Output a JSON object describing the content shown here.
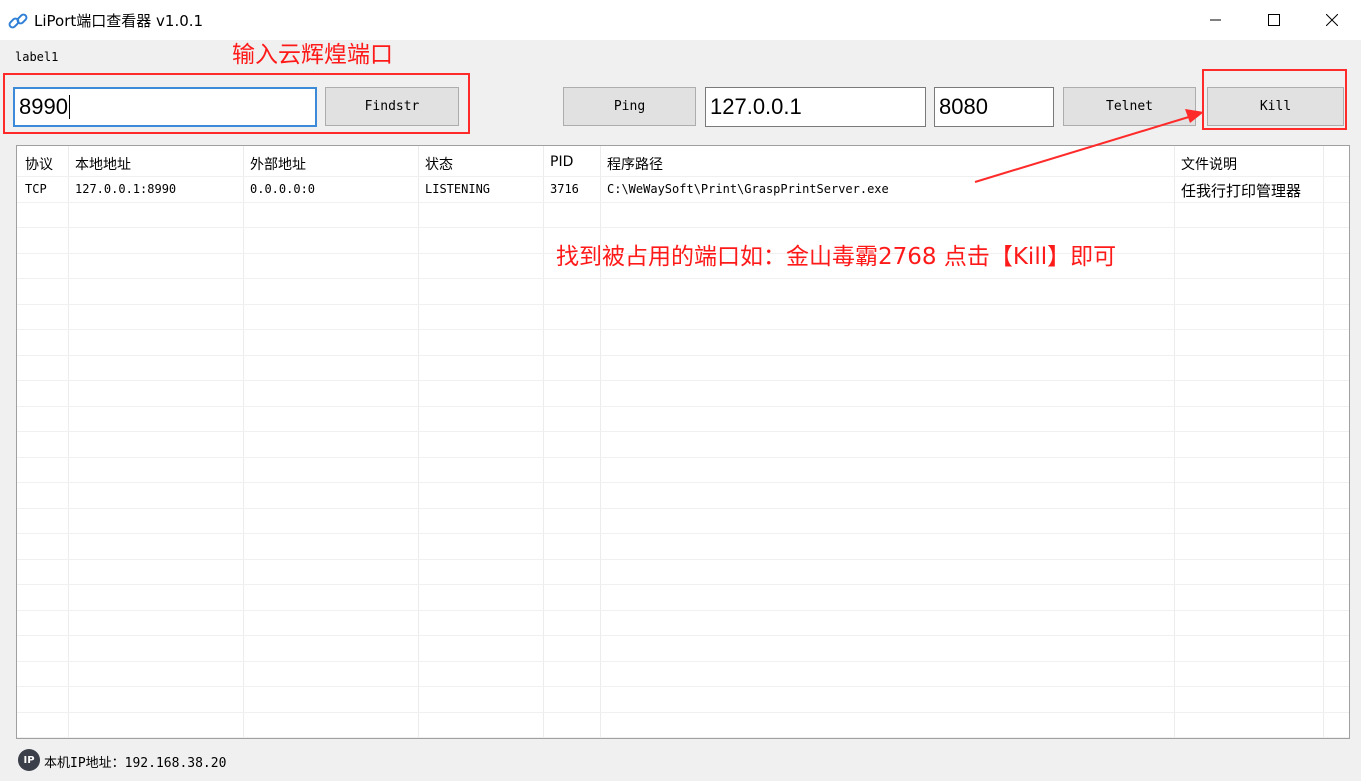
{
  "window": {
    "title": "LiPort端口查看器 v1.0.1",
    "icon": "link-icon"
  },
  "label1": "label1",
  "annotations": {
    "input_hint": "输入云辉煌端口",
    "main_hint": "找到被占用的端口如：金山毒霸2768  点击【Kill】即可",
    "color": "#ff1a1a"
  },
  "toolbar": {
    "port_input_value": "8990",
    "findstr_label": "Findstr",
    "ping_label": "Ping",
    "ip_input_value": "127.0.0.1",
    "telnet_port_value": "8080",
    "telnet_label": "Telnet",
    "kill_label": "Kill"
  },
  "table": {
    "columns": [
      "协议",
      "本地地址",
      "外部地址",
      "状态",
      "PID",
      "程序路径",
      "文件说明"
    ],
    "rows": [
      [
        "TCP",
        "127.0.0.1:8990",
        "0.0.0.0:0",
        "LISTENING",
        "3716",
        "C:\\WeWaySoft\\Print\\GraspPrintServer.exe",
        "任我行打印管理器"
      ]
    ]
  },
  "status": {
    "icon_text": "IP",
    "ip_label": "本机IP地址：",
    "ip_value": "192.168.38.20"
  }
}
